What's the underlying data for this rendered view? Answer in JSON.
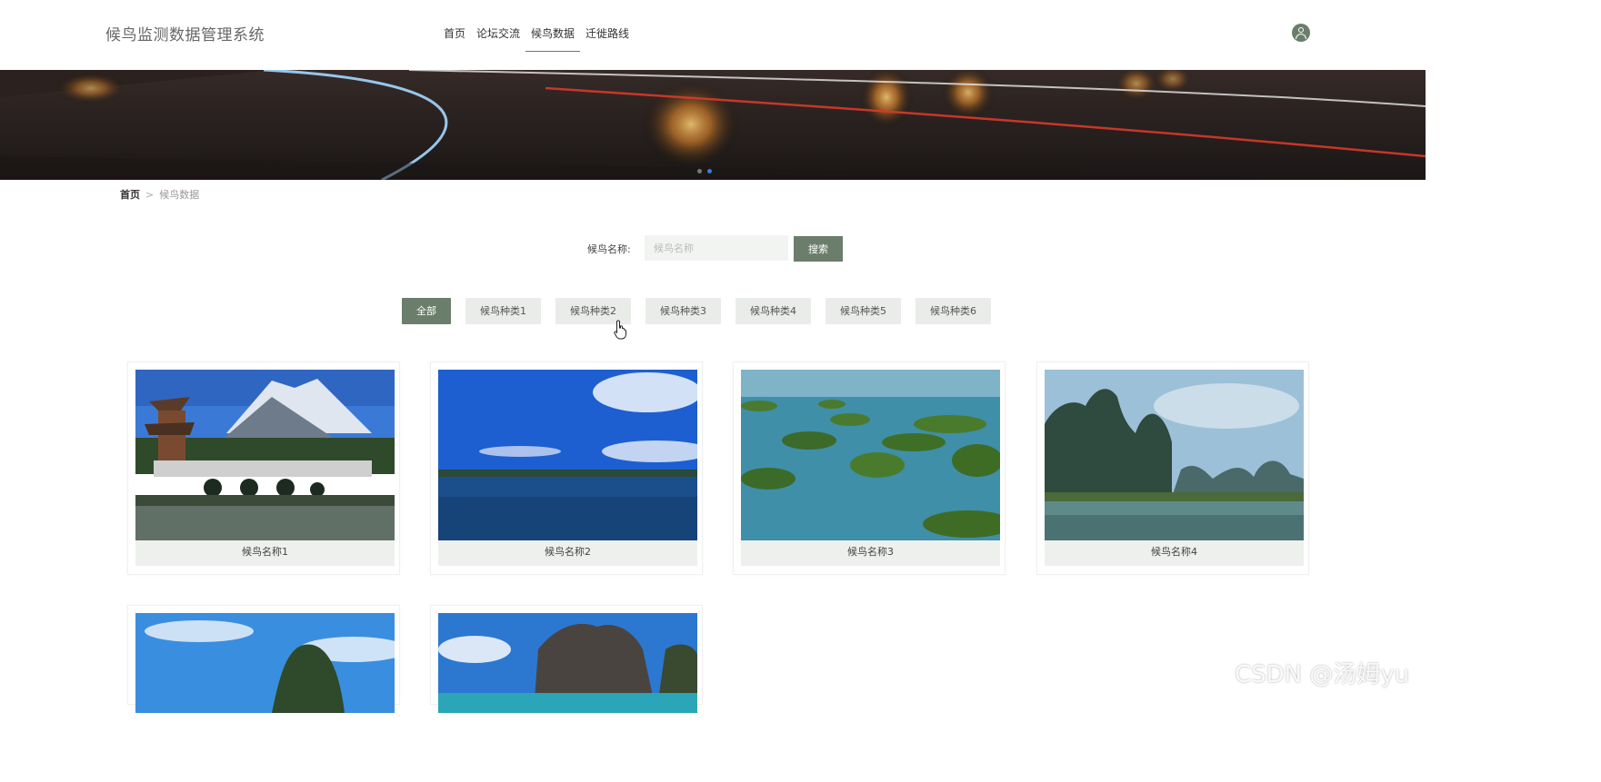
{
  "header": {
    "logo": "候鸟监测数据管理系统",
    "nav": [
      "首页",
      "论坛交流",
      "候鸟数据",
      "迁徙路线"
    ],
    "active_nav": "候鸟数据"
  },
  "breadcrumb": {
    "home": "首页",
    "sep": ">",
    "current": "候鸟数据"
  },
  "search": {
    "label": "候鸟名称:",
    "placeholder": "候鸟名称",
    "button": "搜索"
  },
  "categories": [
    "全部",
    "候鸟种类1",
    "候鸟种类2",
    "候鸟种类3",
    "候鸟种类4",
    "候鸟种类5",
    "候鸟种类6"
  ],
  "active_category": "全部",
  "cards": [
    {
      "name": "候鸟名称1"
    },
    {
      "name": "候鸟名称2"
    },
    {
      "name": "候鸟名称3"
    },
    {
      "name": "候鸟名称4"
    },
    {
      "name": ""
    },
    {
      "name": ""
    }
  ],
  "watermark": "CSDN @汤姆yu",
  "colors": {
    "accent": "#6b7d6b",
    "carousel_active_dot": "#3a7bd5"
  }
}
